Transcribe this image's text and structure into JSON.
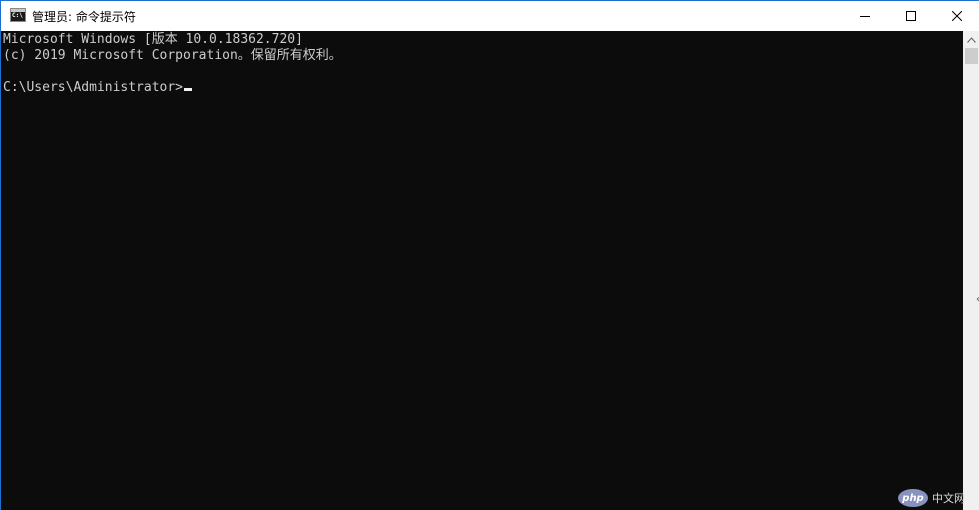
{
  "window": {
    "title": "管理员: 命令提示符",
    "icon": "cmd-app-icon",
    "icon_text": "C:\\"
  },
  "controls": {
    "minimize_icon": "minimize-icon",
    "maximize_icon": "maximize-icon",
    "close_icon": "close-icon"
  },
  "console": {
    "lines": [
      "Microsoft Windows [版本 10.0.18362.720]",
      "(c) 2019 Microsoft Corporation。保留所有权利。",
      "C:\\Users\\Administrator>"
    ],
    "background": "#0c0c0c",
    "foreground": "#cccccc"
  },
  "watermark": {
    "logo": "php",
    "text": "中文网"
  }
}
